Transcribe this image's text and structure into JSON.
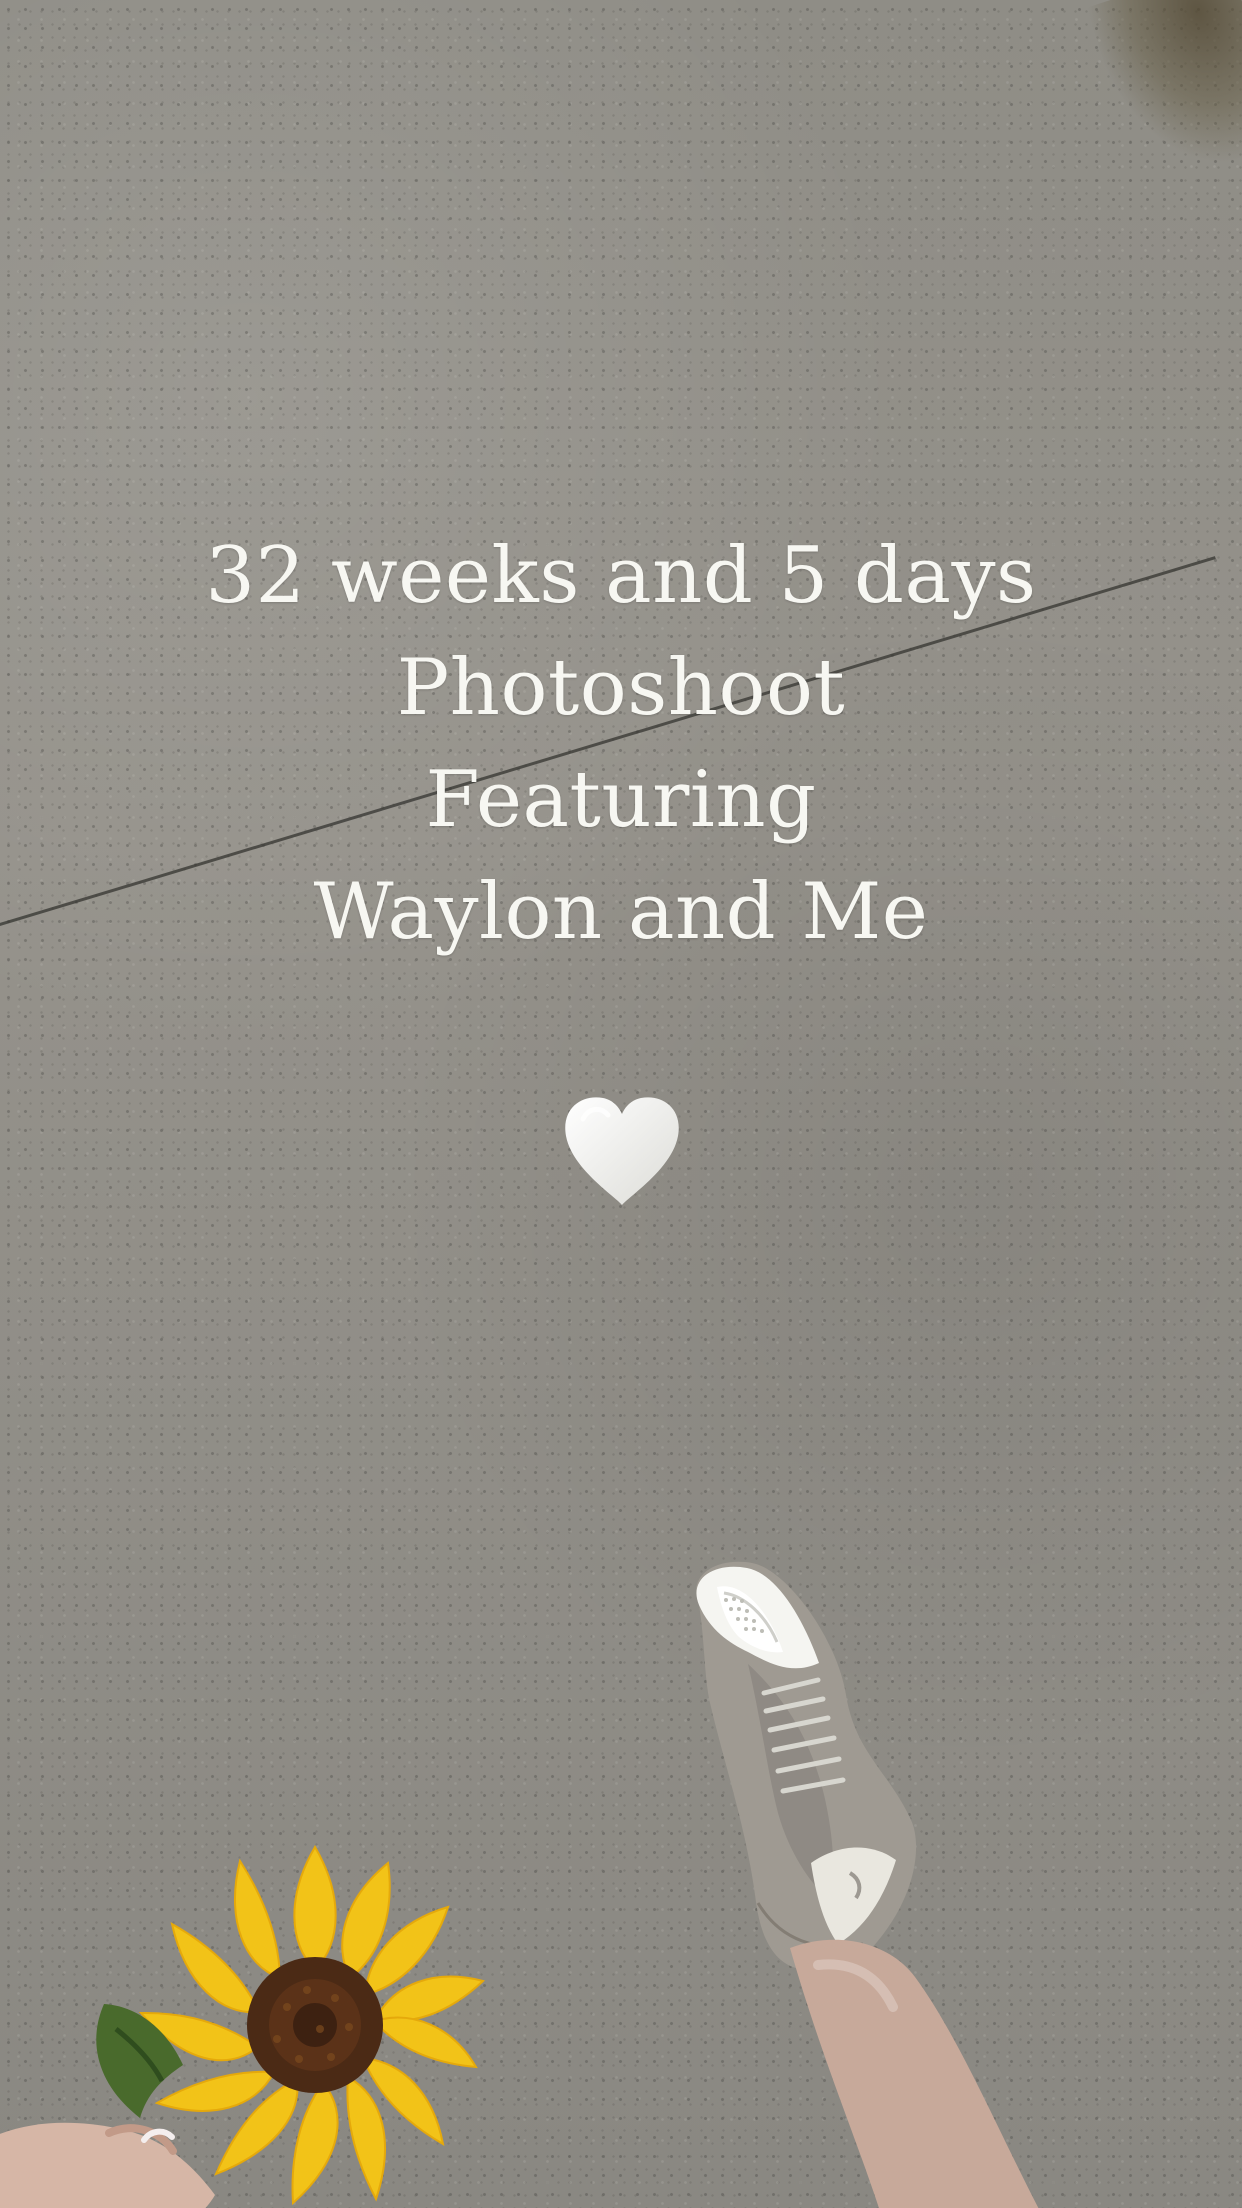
{
  "story": {
    "text_lines": [
      "32 weeks and 5 days",
      "Photoshoot",
      "Featuring",
      "Waylon and Me"
    ],
    "emoji": "white-heart"
  },
  "colors": {
    "text": "#f7f7f2",
    "pavement": "#8f8d87",
    "sunflower_petal": "#f2c318",
    "sunflower_center": "#4b2a15",
    "shoe_gray": "#9d9992"
  }
}
